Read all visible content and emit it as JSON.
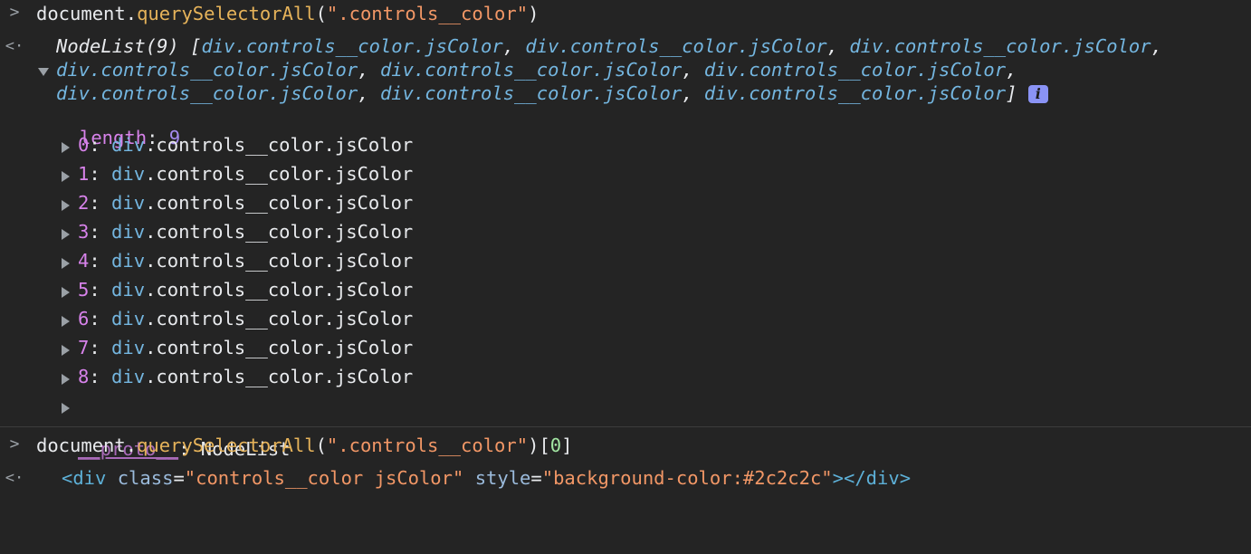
{
  "input1": {
    "prompt_icon": ">",
    "object": "document",
    "dot": ".",
    "method": "querySelectorAll",
    "open": "(",
    "arg": "\".controls__color\"",
    "close": ")"
  },
  "result1": {
    "result_icon": "<·",
    "summary_type": "NodeList(9)",
    "summary_open": " [",
    "summary_items": [
      "div.controls__color.jsColor",
      "div.controls__color.jsColor",
      "div.controls__color.jsColor",
      "div.controls__color.jsColor",
      "div.controls__color.jsColor",
      "div.controls__color.jsColor",
      "div.controls__color.jsColor",
      "div.controls__color.jsColor",
      "div.controls__color.jsColor"
    ],
    "sep": ", ",
    "summary_close": "]",
    "info_icon": "i",
    "length_key": "length",
    "length_colon": ": ",
    "length_value": "9",
    "entries": [
      {
        "key": "0",
        "tag": "div",
        "cls": ".controls__color.jsColor"
      },
      {
        "key": "1",
        "tag": "div",
        "cls": ".controls__color.jsColor"
      },
      {
        "key": "2",
        "tag": "div",
        "cls": ".controls__color.jsColor"
      },
      {
        "key": "3",
        "tag": "div",
        "cls": ".controls__color.jsColor"
      },
      {
        "key": "4",
        "tag": "div",
        "cls": ".controls__color.jsColor"
      },
      {
        "key": "5",
        "tag": "div",
        "cls": ".controls__color.jsColor"
      },
      {
        "key": "6",
        "tag": "div",
        "cls": ".controls__color.jsColor"
      },
      {
        "key": "7",
        "tag": "div",
        "cls": ".controls__color.jsColor"
      },
      {
        "key": "8",
        "tag": "div",
        "cls": ".controls__color.jsColor"
      }
    ],
    "proto_key": "__proto__",
    "proto_colon": ": ",
    "proto_value": "NodeList"
  },
  "input2": {
    "prompt_icon": ">",
    "object": "document",
    "dot": ".",
    "method": "querySelectorAll",
    "open": "(",
    "arg": "\".controls__color\"",
    "close": ")",
    "idx_open": "[",
    "idx": "0",
    "idx_close": "]"
  },
  "result2": {
    "result_icon": "<·",
    "lt": "<",
    "tag": "div",
    "attr1_name": "class",
    "eq": "=",
    "attr1_value": "\"controls__color jsColor\"",
    "attr2_name": "style",
    "attr2_value": "\"background-color:#2c2c2c\"",
    "gt": ">",
    "close_tag": "</div>"
  }
}
